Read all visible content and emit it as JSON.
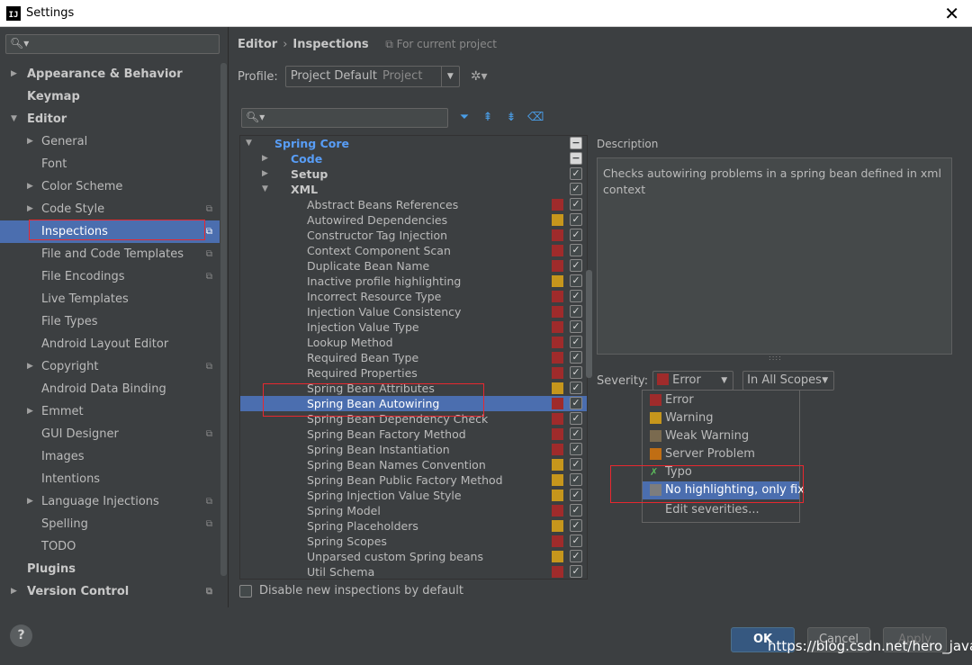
{
  "window": {
    "title": "Settings",
    "app_icon": "IJ",
    "close": "✕"
  },
  "left": {
    "items": [
      {
        "label": "Appearance & Behavior",
        "bold": true,
        "arrow": "right",
        "indent": 0
      },
      {
        "label": "Keymap",
        "bold": true,
        "arrow": "",
        "indent": 0
      },
      {
        "label": "Editor",
        "bold": true,
        "arrow": "down",
        "indent": 0
      },
      {
        "label": "General",
        "bold": false,
        "arrow": "right",
        "indent": 1
      },
      {
        "label": "Font",
        "bold": false,
        "arrow": "",
        "indent": 1
      },
      {
        "label": "Color Scheme",
        "bold": false,
        "arrow": "right",
        "indent": 1
      },
      {
        "label": "Code Style",
        "bold": false,
        "arrow": "right",
        "indent": 1,
        "project": true
      },
      {
        "label": "Inspections",
        "bold": false,
        "arrow": "",
        "indent": 1,
        "project": true,
        "selected": true
      },
      {
        "label": "File and Code Templates",
        "bold": false,
        "arrow": "",
        "indent": 1,
        "project": true
      },
      {
        "label": "File Encodings",
        "bold": false,
        "arrow": "",
        "indent": 1,
        "project": true
      },
      {
        "label": "Live Templates",
        "bold": false,
        "arrow": "",
        "indent": 1
      },
      {
        "label": "File Types",
        "bold": false,
        "arrow": "",
        "indent": 1
      },
      {
        "label": "Android Layout Editor",
        "bold": false,
        "arrow": "",
        "indent": 1
      },
      {
        "label": "Copyright",
        "bold": false,
        "arrow": "right",
        "indent": 1,
        "project": true
      },
      {
        "label": "Android Data Binding",
        "bold": false,
        "arrow": "",
        "indent": 1
      },
      {
        "label": "Emmet",
        "bold": false,
        "arrow": "right",
        "indent": 1
      },
      {
        "label": "GUI Designer",
        "bold": false,
        "arrow": "",
        "indent": 1,
        "project": true
      },
      {
        "label": "Images",
        "bold": false,
        "arrow": "",
        "indent": 1
      },
      {
        "label": "Intentions",
        "bold": false,
        "arrow": "",
        "indent": 1
      },
      {
        "label": "Language Injections",
        "bold": false,
        "arrow": "right",
        "indent": 1,
        "project": true
      },
      {
        "label": "Spelling",
        "bold": false,
        "arrow": "",
        "indent": 1,
        "project": true
      },
      {
        "label": "TODO",
        "bold": false,
        "arrow": "",
        "indent": 1
      },
      {
        "label": "Plugins",
        "bold": true,
        "arrow": "",
        "indent": 0
      },
      {
        "label": "Version Control",
        "bold": true,
        "arrow": "right",
        "indent": 0,
        "project": true
      }
    ]
  },
  "breadcrumb": {
    "editor": "Editor",
    "sep": "›",
    "inspections": "Inspections",
    "scope": "For current project"
  },
  "profile": {
    "label": "Profile:",
    "value": "Project Default",
    "sub": "Project"
  },
  "tree": {
    "rows": [
      {
        "label": "Spring Core",
        "level": 0,
        "arrow": "down",
        "style": "blue",
        "check": "minus"
      },
      {
        "label": "Code",
        "level": 1,
        "arrow": "right",
        "style": "blue",
        "check": "minus"
      },
      {
        "label": "Setup",
        "level": 1,
        "arrow": "right",
        "style": "bold",
        "check": "check"
      },
      {
        "label": "XML",
        "level": 1,
        "arrow": "down",
        "style": "bold",
        "check": "check"
      },
      {
        "label": "Abstract Beans References",
        "level": 2,
        "sev": "#9f2b2b",
        "check": "check"
      },
      {
        "label": "Autowired Dependencies",
        "level": 2,
        "sev": "#c6961c",
        "check": "check"
      },
      {
        "label": "Constructor Tag Injection",
        "level": 2,
        "sev": "#9f2b2b",
        "check": "check"
      },
      {
        "label": "Context Component Scan",
        "level": 2,
        "sev": "#9f2b2b",
        "check": "check"
      },
      {
        "label": "Duplicate Bean Name",
        "level": 2,
        "sev": "#9f2b2b",
        "check": "check"
      },
      {
        "label": "Inactive profile highlighting",
        "level": 2,
        "sev": "#c6961c",
        "check": "check"
      },
      {
        "label": "Incorrect Resource Type",
        "level": 2,
        "sev": "#9f2b2b",
        "check": "check"
      },
      {
        "label": "Injection Value Consistency",
        "level": 2,
        "sev": "#9f2b2b",
        "check": "check"
      },
      {
        "label": "Injection Value Type",
        "level": 2,
        "sev": "#9f2b2b",
        "check": "check"
      },
      {
        "label": "Lookup Method",
        "level": 2,
        "sev": "#9f2b2b",
        "check": "check"
      },
      {
        "label": "Required Bean Type",
        "level": 2,
        "sev": "#9f2b2b",
        "check": "check"
      },
      {
        "label": "Required Properties",
        "level": 2,
        "sev": "#9f2b2b",
        "check": "check"
      },
      {
        "label": "Spring Bean Attributes",
        "level": 2,
        "sev": "#c6961c",
        "check": "check"
      },
      {
        "label": "Spring Bean Autowiring",
        "level": 2,
        "sev": "#9f2b2b",
        "check": "check",
        "selected": true
      },
      {
        "label": "Spring Bean Dependency Check",
        "level": 2,
        "sev": "#9f2b2b",
        "check": "check"
      },
      {
        "label": "Spring Bean Factory Method",
        "level": 2,
        "sev": "#9f2b2b",
        "check": "check"
      },
      {
        "label": "Spring Bean Instantiation",
        "level": 2,
        "sev": "#9f2b2b",
        "check": "check"
      },
      {
        "label": "Spring Bean Names Convention",
        "level": 2,
        "sev": "#c6961c",
        "check": "check"
      },
      {
        "label": "Spring Bean Public Factory Method",
        "level": 2,
        "sev": "#c6961c",
        "check": "check"
      },
      {
        "label": "Spring Injection Value Style",
        "level": 2,
        "sev": "#c6961c",
        "check": "check"
      },
      {
        "label": "Spring Model",
        "level": 2,
        "sev": "#9f2b2b",
        "check": "check"
      },
      {
        "label": "Spring Placeholders",
        "level": 2,
        "sev": "#c6961c",
        "check": "check"
      },
      {
        "label": "Spring Scopes",
        "level": 2,
        "sev": "#9f2b2b",
        "check": "check"
      },
      {
        "label": "Unparsed custom Spring beans",
        "level": 2,
        "sev": "#c6961c",
        "check": "check"
      },
      {
        "label": "Util Schema",
        "level": 2,
        "sev": "#9f2b2b",
        "check": "check"
      }
    ]
  },
  "disable_new": {
    "label": "Disable new inspections by default"
  },
  "description": {
    "label": "Description",
    "text": "Checks autowiring problems in a spring bean defined in xml context"
  },
  "severity": {
    "label": "Severity:",
    "value": "Error",
    "color": "#9f2b2b",
    "scope": "In All Scopes"
  },
  "popup": {
    "items": [
      {
        "label": "Error",
        "color": "#9f2b2b"
      },
      {
        "label": "Warning",
        "color": "#c6961c"
      },
      {
        "label": "Weak Warning",
        "color": "#7a6a4f"
      },
      {
        "label": "Server Problem",
        "color": "#c06e14"
      },
      {
        "label": "Typo",
        "icon": "typo-icon"
      },
      {
        "label": "No highlighting, only fix",
        "color": "#7d7d7d",
        "highlighted": true
      }
    ],
    "edit": "Edit severities..."
  },
  "buttons": {
    "help": "?",
    "ok": "OK",
    "cancel": "Cancel",
    "apply": "Apply"
  },
  "watermark": "https://blog.csdn.net/hero_java"
}
